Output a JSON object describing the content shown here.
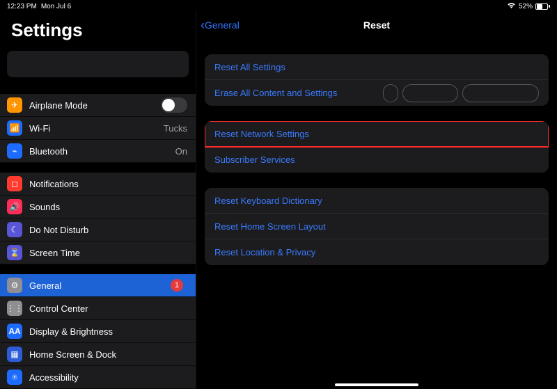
{
  "statusbar": {
    "time": "12:23 PM",
    "date": "Mon Jul 6",
    "battery_pct": "52%",
    "battery_fill_pct": 52
  },
  "sidebar": {
    "title": "Settings",
    "groups": [
      [
        {
          "id": "airplane",
          "label": "Airplane Mode",
          "iconClass": "ic-airplane",
          "glyph": "✈",
          "type": "toggle",
          "toggled": false
        },
        {
          "id": "wifi",
          "label": "Wi-Fi",
          "iconClass": "ic-wifi",
          "glyph": "📶",
          "value": "Tucks"
        },
        {
          "id": "bluetooth",
          "label": "Bluetooth",
          "iconClass": "ic-bt",
          "glyph": "⌁",
          "value": "On"
        }
      ],
      [
        {
          "id": "notifications",
          "label": "Notifications",
          "iconClass": "ic-notif",
          "glyph": "◻"
        },
        {
          "id": "sounds",
          "label": "Sounds",
          "iconClass": "ic-sound",
          "glyph": "🔊"
        },
        {
          "id": "dnd",
          "label": "Do Not Disturb",
          "iconClass": "ic-dnd",
          "glyph": "☾"
        },
        {
          "id": "screentime",
          "label": "Screen Time",
          "iconClass": "ic-screentime",
          "glyph": "⌛"
        }
      ],
      [
        {
          "id": "general",
          "label": "General",
          "iconClass": "ic-general",
          "glyph": "⚙",
          "selected": true,
          "badge": "1"
        },
        {
          "id": "controlcenter",
          "label": "Control Center",
          "iconClass": "ic-cc",
          "glyph": "⋮⋮"
        },
        {
          "id": "display",
          "label": "Display & Brightness",
          "iconClass": "ic-disp",
          "glyph": "AA"
        },
        {
          "id": "homescreen",
          "label": "Home Screen & Dock",
          "iconClass": "ic-home",
          "glyph": "▦"
        },
        {
          "id": "accessibility",
          "label": "Accessibility",
          "iconClass": "ic-acc",
          "glyph": "⍟"
        }
      ]
    ]
  },
  "detail": {
    "back_label": "General",
    "title": "Reset",
    "sections": [
      [
        {
          "id": "reset-all",
          "label": "Reset All Settings"
        },
        {
          "id": "erase-all",
          "label": "Erase All Content and Settings",
          "pills": [
            "text",
            "md",
            "lg"
          ]
        }
      ],
      [
        {
          "id": "reset-network",
          "label": "Reset Network Settings",
          "highlight": true
        },
        {
          "id": "subscriber",
          "label": "Subscriber Services"
        }
      ],
      [
        {
          "id": "reset-keyboard",
          "label": "Reset Keyboard Dictionary"
        },
        {
          "id": "reset-home",
          "label": "Reset Home Screen Layout"
        },
        {
          "id": "reset-location",
          "label": "Reset Location & Privacy"
        }
      ]
    ]
  }
}
